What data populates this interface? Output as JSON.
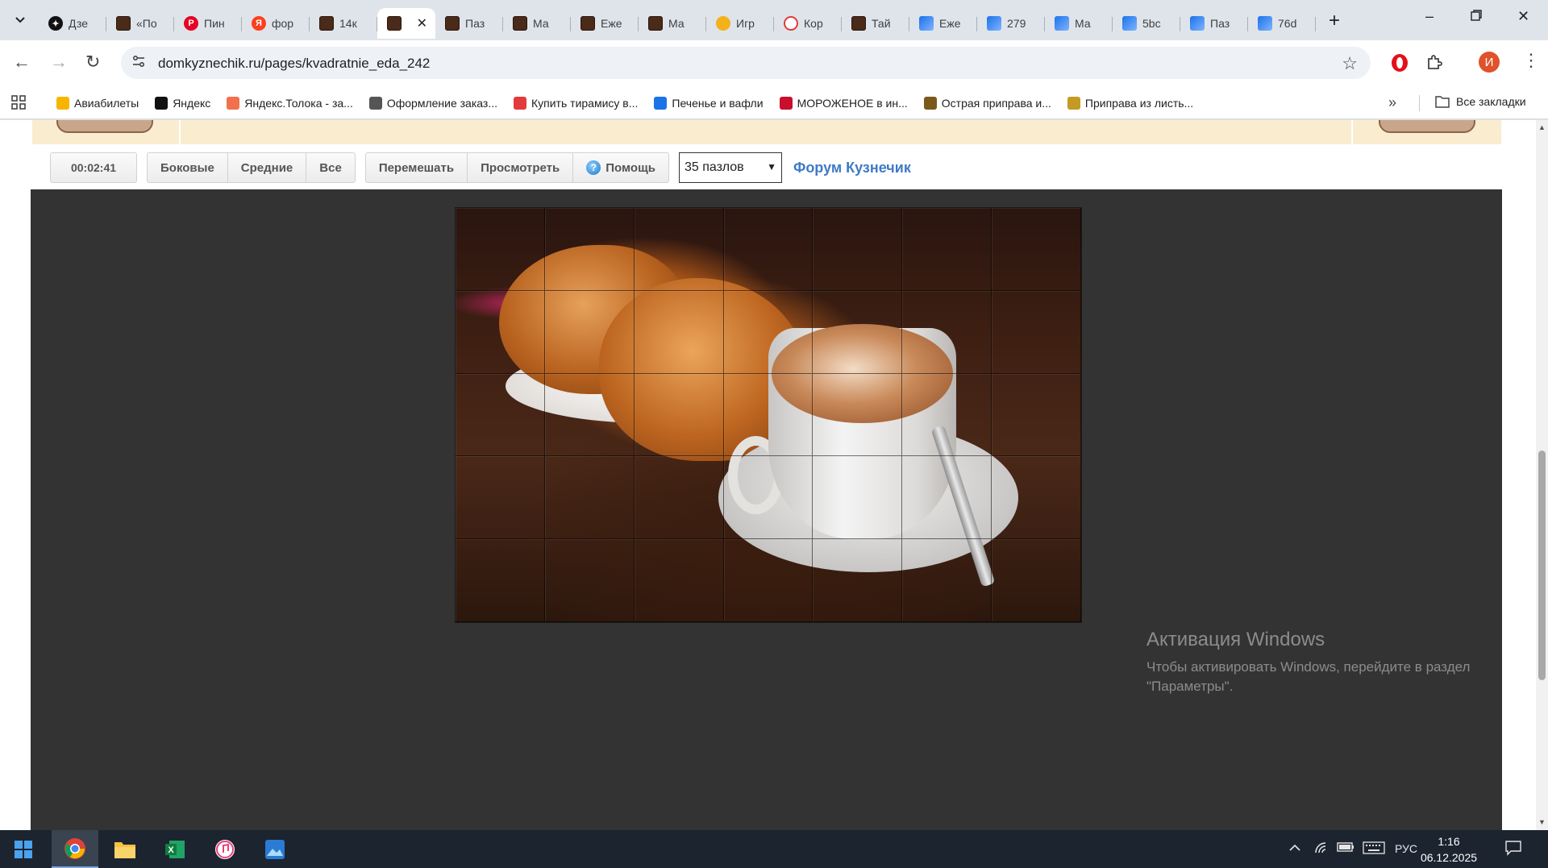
{
  "browser": {
    "tabs": [
      {
        "label": "Дзе",
        "icon": "dzen-icon"
      },
      {
        "label": "«По",
        "icon": "puzzle-favicon-icon"
      },
      {
        "label": "Пин",
        "icon": "pinterest-icon"
      },
      {
        "label": "фор",
        "icon": "yandex-icon"
      },
      {
        "label": "14к",
        "icon": "puzzle-favicon-icon"
      },
      {
        "label": "",
        "icon": "puzzle-favicon-icon",
        "active": true
      },
      {
        "label": "Паз",
        "icon": "puzzle-favicon-icon"
      },
      {
        "label": "Ма",
        "icon": "puzzle-favicon-icon"
      },
      {
        "label": "Еже",
        "icon": "puzzle-favicon-icon"
      },
      {
        "label": "Ма",
        "icon": "puzzle-favicon-icon"
      },
      {
        "label": "Игр",
        "icon": "game-icon"
      },
      {
        "label": "Кор",
        "icon": "korona-icon"
      },
      {
        "label": "Тай",
        "icon": "puzzle-favicon-icon"
      },
      {
        "label": "Еже",
        "icon": "image-icon"
      },
      {
        "label": "279",
        "icon": "image-icon"
      },
      {
        "label": "Ма",
        "icon": "image-icon"
      },
      {
        "label": "5bc",
        "icon": "image-icon"
      },
      {
        "label": "Паз",
        "icon": "image-icon"
      },
      {
        "label": "76d",
        "icon": "image-icon"
      }
    ],
    "url": "domkyznechik.ru/pages/kvadratnie_eda_242",
    "profile_initial": "И",
    "bookmarks": [
      {
        "label": "Авиабилеты",
        "icon": "plane-icon"
      },
      {
        "label": "Яндекс",
        "icon": "yandex-plus-icon"
      },
      {
        "label": "Яндекс.Толока - за...",
        "icon": "toloka-icon"
      },
      {
        "label": "Оформление заказ...",
        "icon": "globe-icon"
      },
      {
        "label": "Купить тирамису в...",
        "icon": "korona-icon"
      },
      {
        "label": "Печенье и вафли",
        "icon": "basket-icon"
      },
      {
        "label": "МОРОЖЕНОЕ в ин...",
        "icon": "d-icon"
      },
      {
        "label": "Острая приправа и...",
        "icon": "spice-icon"
      },
      {
        "label": "Приправа из листь...",
        "icon": "ji-icon"
      }
    ],
    "all_bookmarks_label": "Все закладки"
  },
  "page": {
    "timer": "00:02:41",
    "filter_buttons": [
      "Боковые",
      "Средние",
      "Все"
    ],
    "action_buttons": {
      "shuffle": "Перемешать",
      "preview": "Просмотреть",
      "help": "Помощь"
    },
    "pieces_select": "35 пазлов",
    "forum_link": "Форум Кузнечик",
    "puzzle": {
      "columns": 7,
      "rows": 5
    }
  },
  "watermark": {
    "title": "Активация Windows",
    "line1": "Чтобы активировать Windows, перейдите в раздел",
    "line2": "\"Параметры\"."
  },
  "taskbar": {
    "language": "РУС",
    "time": "1:16",
    "date": "06.12.2025"
  },
  "colors": {
    "board": "#333333",
    "header_strip": "#faeccf",
    "forum_link": "#3f7ac6",
    "taskbar": "#1c2430"
  }
}
